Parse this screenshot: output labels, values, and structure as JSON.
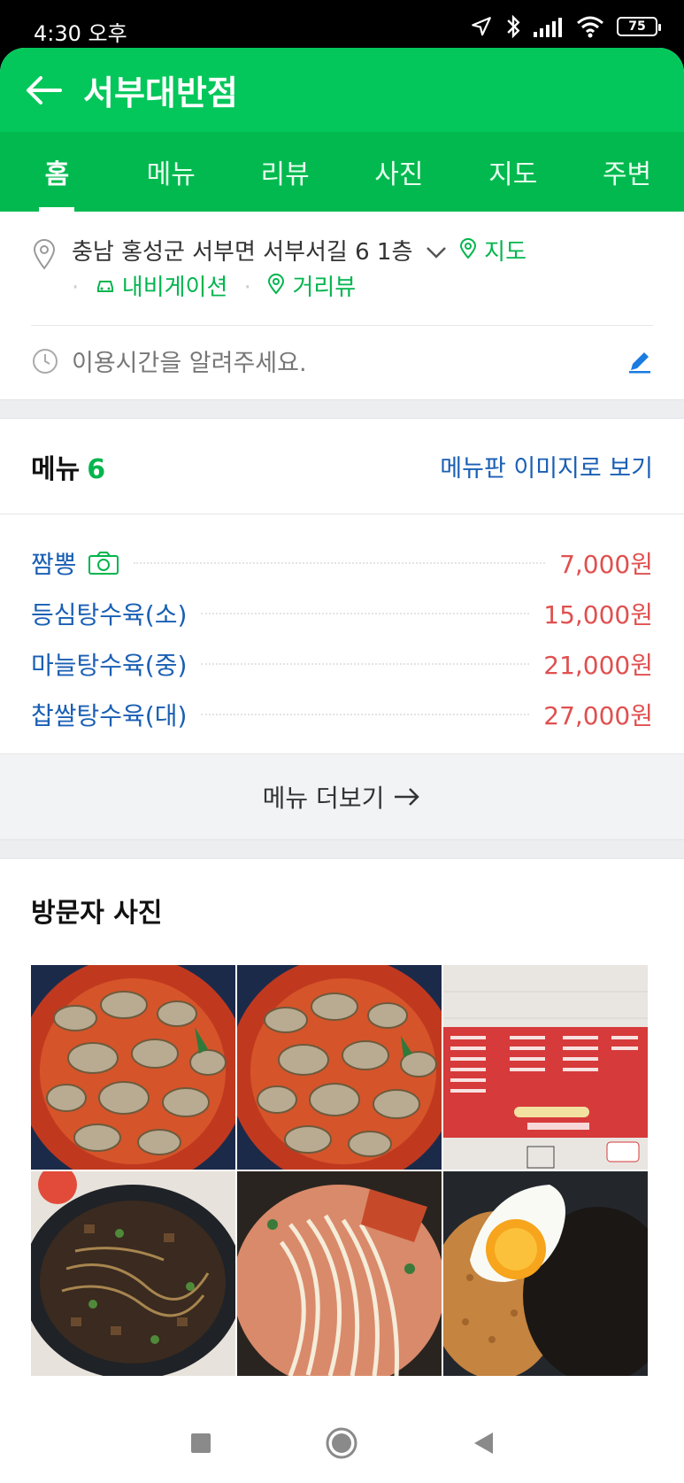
{
  "status": {
    "time": "4:30 오후",
    "battery": "75"
  },
  "header": {
    "title": "서부대반점"
  },
  "tabs": [
    {
      "label": "홈",
      "active": true
    },
    {
      "label": "메뉴"
    },
    {
      "label": "리뷰"
    },
    {
      "label": "사진"
    },
    {
      "label": "지도"
    },
    {
      "label": "주변"
    }
  ],
  "info": {
    "address": "충남 홍성군 서부면 서부서길 6 1층",
    "map_label": "지도",
    "navi_label": "내비게이션",
    "street_label": "거리뷰",
    "hours_placeholder": "이용시간을 알려주세요."
  },
  "menu": {
    "title": "메뉴",
    "count": "6",
    "board_link": "메뉴판 이미지로 보기",
    "items": [
      {
        "name": "짬뽕",
        "price": "7,000원"
      },
      {
        "name": "등심탕수육(소)",
        "price": "15,000원"
      },
      {
        "name": "마늘탕수육(중)",
        "price": "21,000원"
      },
      {
        "name": "찹쌀탕수육(대)",
        "price": "27,000원"
      }
    ],
    "more_label": "메뉴 더보기"
  },
  "photos": {
    "title": "방문자 사진",
    "items": [
      "oyster-jjamppong-photo",
      "oyster-jjamppong-photo",
      "menu-board-photo",
      "jajangmyeon-photo",
      "noodle-soup-photo",
      "fried-rice-egg-photo"
    ]
  },
  "colors": {
    "brand": "#03c75a",
    "link": "#1a5fb4",
    "price": "#e05050"
  }
}
